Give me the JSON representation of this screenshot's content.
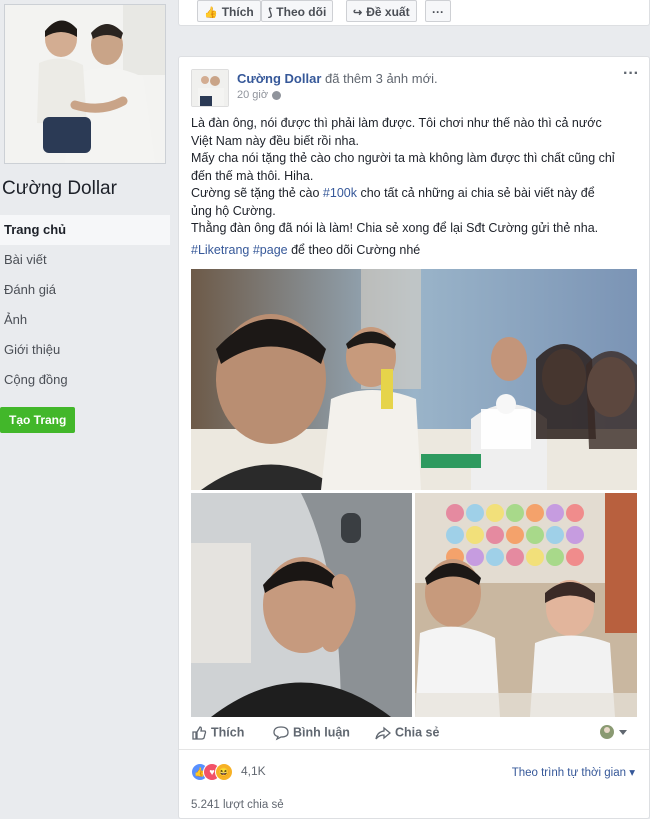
{
  "sidebar": {
    "page_name": "Cường Dollar",
    "nav": [
      {
        "label": "Trang chủ",
        "active": true
      },
      {
        "label": "Bài viết"
      },
      {
        "label": "Đánh giá"
      },
      {
        "label": "Ảnh"
      },
      {
        "label": "Giới thiệu"
      },
      {
        "label": "Cộng đồng"
      }
    ],
    "create_button": "Tạo Trang"
  },
  "top_actions": {
    "like": "Thích",
    "follow": "Theo dõi",
    "suggest": "Đề xuất",
    "more": "···"
  },
  "post": {
    "author": "Cường Dollar",
    "action_text": "đã thêm 3 ảnh mới.",
    "time": "20 giờ",
    "more": "···",
    "lines": [
      "Là đàn ông, nói được thì phải làm được. Tôi chơi như thế nào thì cả nước",
      "Việt Nam này đều biết rồi nha.",
      "Mấy cha nói tặng thẻ cào cho người ta mà không làm được thì chất cũng chỉ",
      "đến thế mà thôi. Hiha."
    ],
    "line5_pre": "Cường sẽ tặng thẻ cào ",
    "line5_tag": "#100k",
    "line5_post": " cho tất cả những ai chia sẻ bài viết này để",
    "line6": "ủng hộ Cường.",
    "line7": "Thằng đàn ông đã nói là làm! Chia sẻ xong để lại Sđt Cường gửi thẻ nha.",
    "tag1": "#Liketrang",
    "tag2": "#page",
    "tag_suffix": " để theo dõi Cường nhé",
    "actions": {
      "like": "Thích",
      "comment": "Bình luận",
      "share": "Chia sẻ"
    },
    "reaction_count": "4,1K",
    "order": "Theo trình tự thời gian",
    "shares": "5.241 lượt chia sẻ"
  },
  "colors": {
    "link": "#365899",
    "green": "#42b72a",
    "like_blue": "#5890ff",
    "love_red": "#f25268",
    "haha_yellow": "#f7b125"
  }
}
